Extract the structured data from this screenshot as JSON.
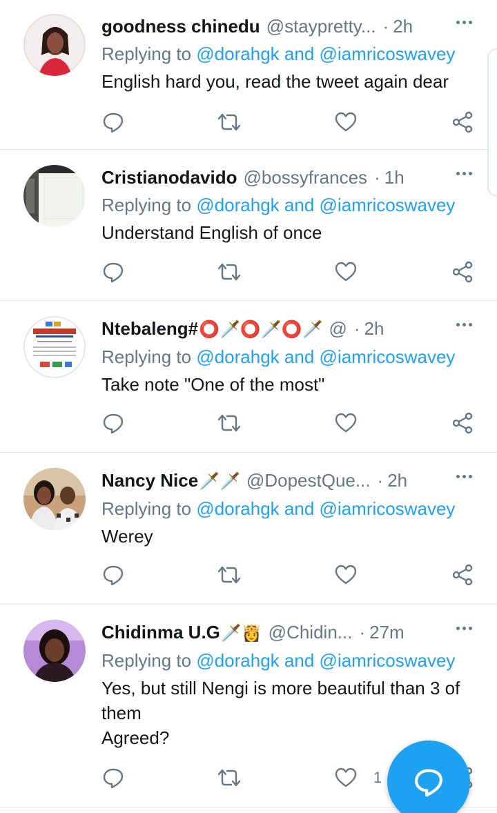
{
  "tweets": [
    {
      "name": "goodness chinedu",
      "emoji": "",
      "handle": "@staypretty...",
      "time": "2h",
      "reply_prefix": "Replying to",
      "reply_user1": "@dorahgk",
      "reply_and": "and",
      "reply_user2": "@iamricoswavey",
      "text": "English hard you, read the tweet again dear",
      "like_count": ""
    },
    {
      "name": "Cristianodavido",
      "emoji": "",
      "handle": "@bossyfrances",
      "time": "1h",
      "reply_prefix": "Replying to",
      "reply_user1": "@dorahgk",
      "reply_and": "and",
      "reply_user2": "@iamricoswavey",
      "text": "Understand English of once",
      "like_count": ""
    },
    {
      "name": "Ntebaleng#",
      "emoji": "⭕🗡️⭕🗡️⭕🗡️",
      "handle": "@",
      "time": "2h",
      "reply_prefix": "Replying to",
      "reply_user1": "@dorahgk",
      "reply_and": "and",
      "reply_user2": "@iamricoswavey",
      "text": "Take note \"One of the most\"",
      "like_count": ""
    },
    {
      "name": "Nancy Nice",
      "emoji": "🗡️🗡️",
      "handle": "@DopestQue...",
      "time": "2h",
      "reply_prefix": "Replying to",
      "reply_user1": "@dorahgk",
      "reply_and": "and",
      "reply_user2": "@iamricoswavey",
      "text": "Werey",
      "like_count": ""
    },
    {
      "name": "Chidinma U.G",
      "emoji": "🗡️👸",
      "handle": "@Chidin...",
      "time": "27m",
      "reply_prefix": "Replying to",
      "reply_user1": "@dorahgk",
      "reply_and": "and",
      "reply_user2": "@iamricoswavey",
      "text": "Yes, but still Nengi is more beautiful than 3 of them",
      "text2": "Agreed?",
      "like_count": "1"
    }
  ],
  "fab": {
    "icon": "compose-reply-icon"
  },
  "colors": {
    "link": "#1da1f2",
    "muted": "#657786",
    "text": "#14171a",
    "divider": "#e1e8ed"
  }
}
